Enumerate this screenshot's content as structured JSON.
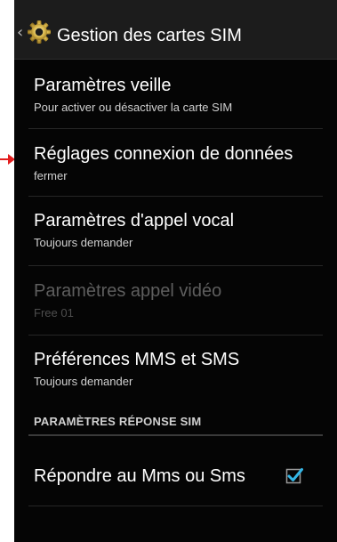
{
  "header": {
    "back_icon": "chevron-left-icon",
    "settings_icon": "gear-icon",
    "title": "Gestion des cartes SIM"
  },
  "items": [
    {
      "title": "Paramètres veille",
      "subtitle": "Pour activer ou désactiver la carte SIM",
      "enabled": true
    },
    {
      "title": "Réglages connexion de données",
      "subtitle": "fermer",
      "enabled": true
    },
    {
      "title": "Paramètres d'appel vocal",
      "subtitle": "Toujours demander",
      "enabled": true
    },
    {
      "title": "Paramètres appel vidéo",
      "subtitle": "Free 01",
      "enabled": false
    },
    {
      "title": "Préférences MMS et SMS",
      "subtitle": "Toujours demander",
      "enabled": true
    }
  ],
  "section": {
    "header": "PARAMÈTRES RÉPONSE SIM",
    "items": [
      {
        "title": "Répondre au Mms ou Sms",
        "checked": true
      }
    ]
  },
  "colors": {
    "background": "#050505",
    "accent": "#33b5e5",
    "pointer": "#e31d1d",
    "text_disabled": "#5e5e5e"
  }
}
